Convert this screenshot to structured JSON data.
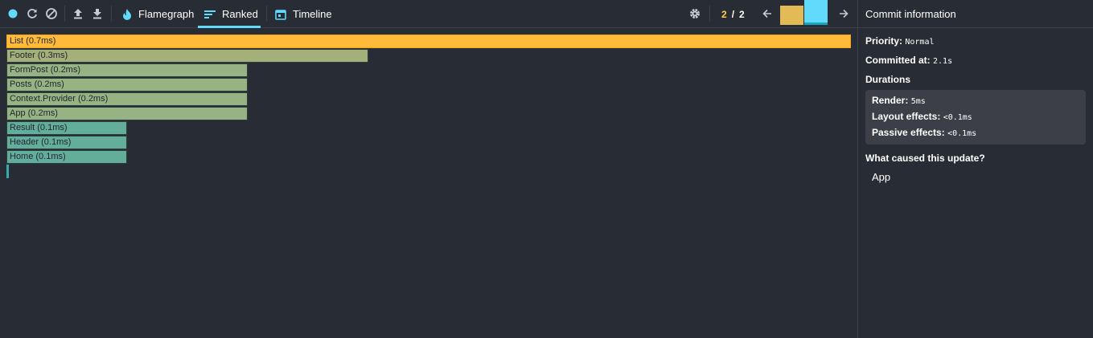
{
  "toolbar": {
    "icons": [
      "record-icon",
      "reload-icon",
      "clear-icon",
      "upload-icon",
      "download-icon"
    ],
    "tabs": [
      {
        "id": "flamegraph",
        "label": "Flamegraph",
        "icon": "flame-icon",
        "active": false
      },
      {
        "id": "ranked",
        "label": "Ranked",
        "icon": "ranked-icon",
        "active": true
      },
      {
        "id": "timeline",
        "label": "Timeline",
        "icon": "timeline-icon",
        "active": false
      }
    ],
    "commit_current": "2",
    "commit_separator": "/",
    "commit_total": "2",
    "commit_bars": [
      {
        "color": "#e2bb57",
        "level": 0.86,
        "selected": false
      },
      {
        "color": "#61dafb",
        "level": 1.0,
        "selected": true
      }
    ],
    "colors": {
      "record": "#61dafb",
      "accent": "#61dafb"
    }
  },
  "chart_data": {
    "type": "bar",
    "orientation": "horizontal",
    "categories": [
      "List",
      "Footer",
      "FormPost",
      "Posts",
      "Context.Provider",
      "App",
      "Result",
      "Header",
      "Home",
      ""
    ],
    "values": [
      0.7,
      0.3,
      0.2,
      0.2,
      0.2,
      0.2,
      0.1,
      0.1,
      0.1,
      0.0
    ],
    "labels": [
      "List (0.7ms)",
      "Footer (0.3ms)",
      "FormPost (0.2ms)",
      "Posts (0.2ms)",
      "Context.Provider (0.2ms)",
      "App (0.2ms)",
      "Result (0.1ms)",
      "Header (0.1ms)",
      "Home (0.1ms)",
      ""
    ],
    "colors": [
      "#ffba3a",
      "#a3b07a",
      "#97b384",
      "#97b384",
      "#97b384",
      "#97b384",
      "#63ae9b",
      "#63ae9b",
      "#63ae9b",
      "#37a9b0"
    ],
    "xlim": [
      0,
      0.7
    ],
    "selected_index": 0
  },
  "sidebar": {
    "header": "Commit information",
    "priority_label": "Priority:",
    "priority_value": "Normal",
    "committed_label": "Committed at:",
    "committed_value": "2.1s",
    "durations_label": "Durations",
    "durations": [
      {
        "label": "Render:",
        "value": "5ms"
      },
      {
        "label": "Layout effects:",
        "value": "<0.1ms"
      },
      {
        "label": "Passive effects:",
        "value": "<0.1ms"
      }
    ],
    "cause_label": "What caused this update?",
    "cause_items": [
      "App"
    ]
  }
}
